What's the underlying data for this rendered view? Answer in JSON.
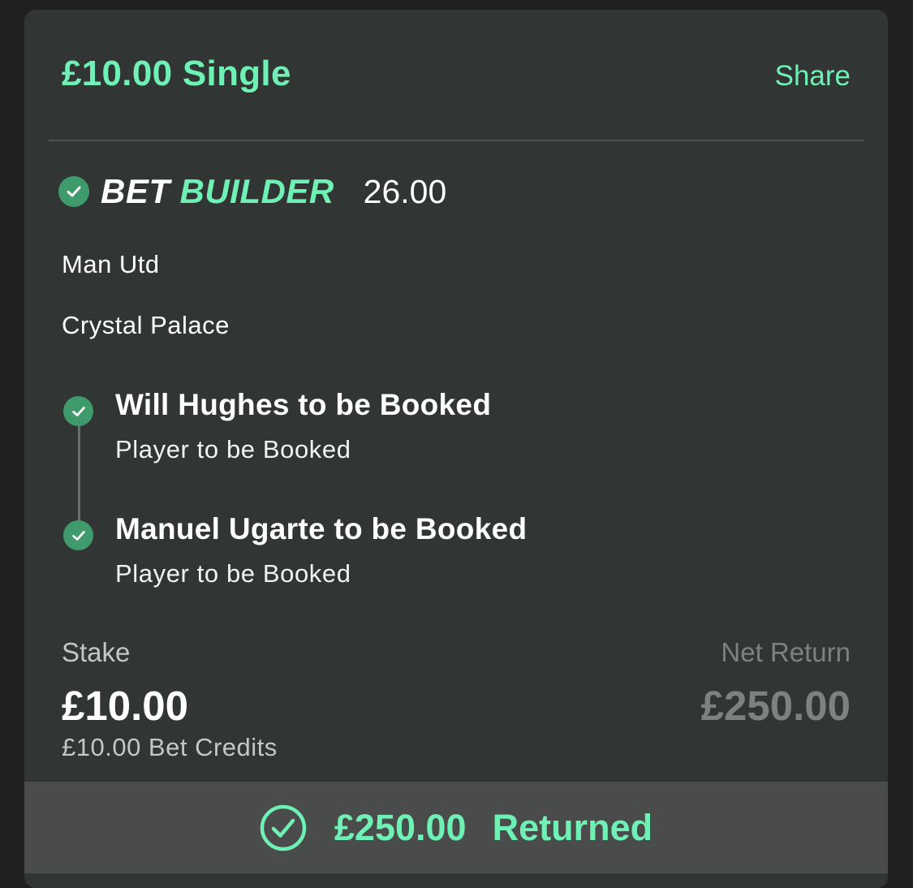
{
  "bet": {
    "title": "£10.00 Single",
    "share_label": "Share"
  },
  "bet_builder": {
    "icon": "check-circle-icon",
    "logo_word1": "BET",
    "logo_word2": "BUILDER",
    "odds": "26.00"
  },
  "match": {
    "team1": "Man Utd",
    "team2": "Crystal Palace"
  },
  "selections": [
    {
      "title": "Will Hughes to be Booked",
      "market": "Player to be Booked",
      "icon": "check-circle-icon"
    },
    {
      "title": "Manuel Ugarte to be Booked",
      "market": "Player to be Booked",
      "icon": "check-circle-icon"
    }
  ],
  "stake": {
    "label": "Stake",
    "value": "£10.00",
    "credits": "£10.00 Bet Credits"
  },
  "net_return": {
    "label": "Net Return",
    "value": "£250.00"
  },
  "footer": {
    "icon": "check-circle-outline-icon",
    "amount": "£250.00",
    "status": "Returned"
  },
  "colors": {
    "accent": "#6ff0b4",
    "check_green": "#3f9a6c",
    "card_bg": "#313634",
    "footer_bg": "#494c4b",
    "muted": "#7d8280"
  }
}
